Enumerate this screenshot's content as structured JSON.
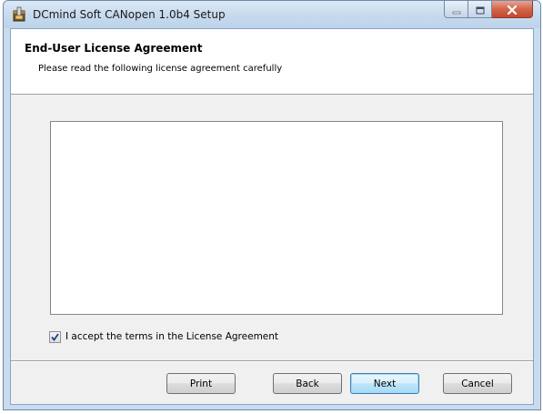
{
  "window": {
    "title": "DCmind Soft CANopen 1.0b4 Setup"
  },
  "header": {
    "title": "End-User License Agreement",
    "subtitle": "Please read the following license agreement carefully"
  },
  "license": {
    "text": ""
  },
  "accept": {
    "label": "I accept the terms in the License Agreement",
    "checked": true
  },
  "buttons": {
    "print": "Print",
    "back": "Back",
    "next": "Next",
    "cancel": "Cancel"
  },
  "icons": {
    "app": "installer-package-icon",
    "minimize": "minimize-icon",
    "maximize": "maximize-icon",
    "close": "close-icon",
    "check": "checkmark-icon"
  },
  "colors": {
    "titlebar": "#c8dbef",
    "close_button": "#c34a30",
    "dialog_background": "#f0f0f0",
    "default_button_border": "#3c7fb1"
  }
}
